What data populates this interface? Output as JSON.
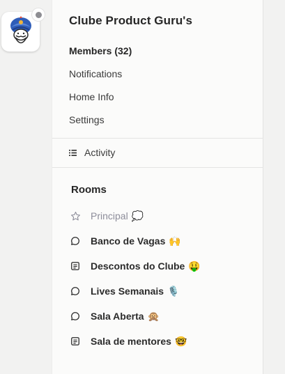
{
  "club": {
    "name": "Clube Product Guru's"
  },
  "menu": {
    "members": "Members (32)",
    "notifications": "Notifications",
    "home_info": "Home Info",
    "settings": "Settings"
  },
  "activity": {
    "label": "Activity"
  },
  "rooms": {
    "heading": "Rooms",
    "items": [
      {
        "label": "Principal",
        "emoji": "💭",
        "icon": "star-icon"
      },
      {
        "label": "Banco de Vagas",
        "emoji": "🙌",
        "icon": "chat-bubble-icon"
      },
      {
        "label": "Descontos do Clube",
        "emoji": "🤑",
        "icon": "document-icon"
      },
      {
        "label": "Lives Semanais",
        "emoji": "🎙️",
        "icon": "chat-bubble-icon"
      },
      {
        "label": "Sala Aberta",
        "emoji": "🙊",
        "icon": "chat-bubble-icon"
      },
      {
        "label": "Sala de mentores",
        "emoji": "🤓",
        "icon": "document-icon"
      }
    ]
  },
  "colors": {
    "panel_bg": "#fbfbfa",
    "rail_bg": "#f2f2f1",
    "muted_text": "#8d8d9a",
    "turban_blue": "#2f5db8",
    "turban_gem": "#f0b43a"
  }
}
